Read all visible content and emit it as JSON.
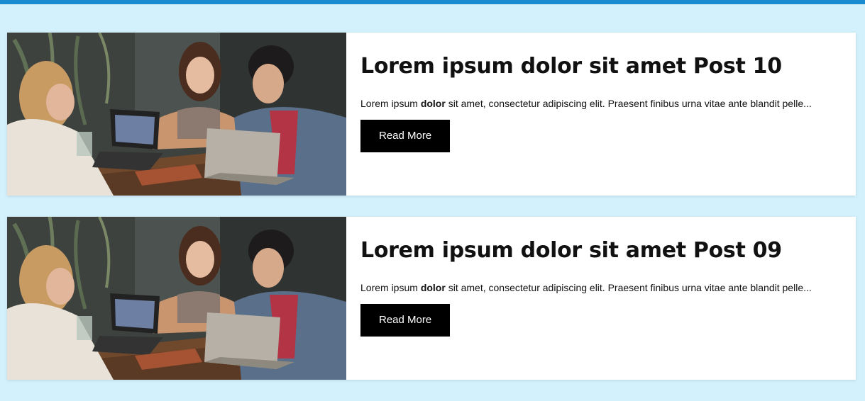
{
  "colors": {
    "top_bar": "#1a8bd0",
    "page_background": "#d3f1fc",
    "card_background": "#ffffff",
    "button_background": "#000000"
  },
  "posts": [
    {
      "title": "Lorem ipsum dolor sit amet Post 10",
      "excerpt_before": "Lorem ipsum ",
      "excerpt_bold": "dolor",
      "excerpt_after": " sit amet, consectetur adipiscing elit. Praesent finibus urna vitae ante blandit pelle...",
      "button_label": "Read More",
      "image": "photo of three people laughing at a cafe table with laptops"
    },
    {
      "title": "Lorem ipsum dolor sit amet Post 09",
      "excerpt_before": "Lorem ipsum ",
      "excerpt_bold": "dolor",
      "excerpt_after": " sit amet, consectetur adipiscing elit. Praesent finibus urna vitae ante blandit pelle...",
      "button_label": "Read More",
      "image": "photo of three people laughing at a cafe table with laptops"
    }
  ]
}
